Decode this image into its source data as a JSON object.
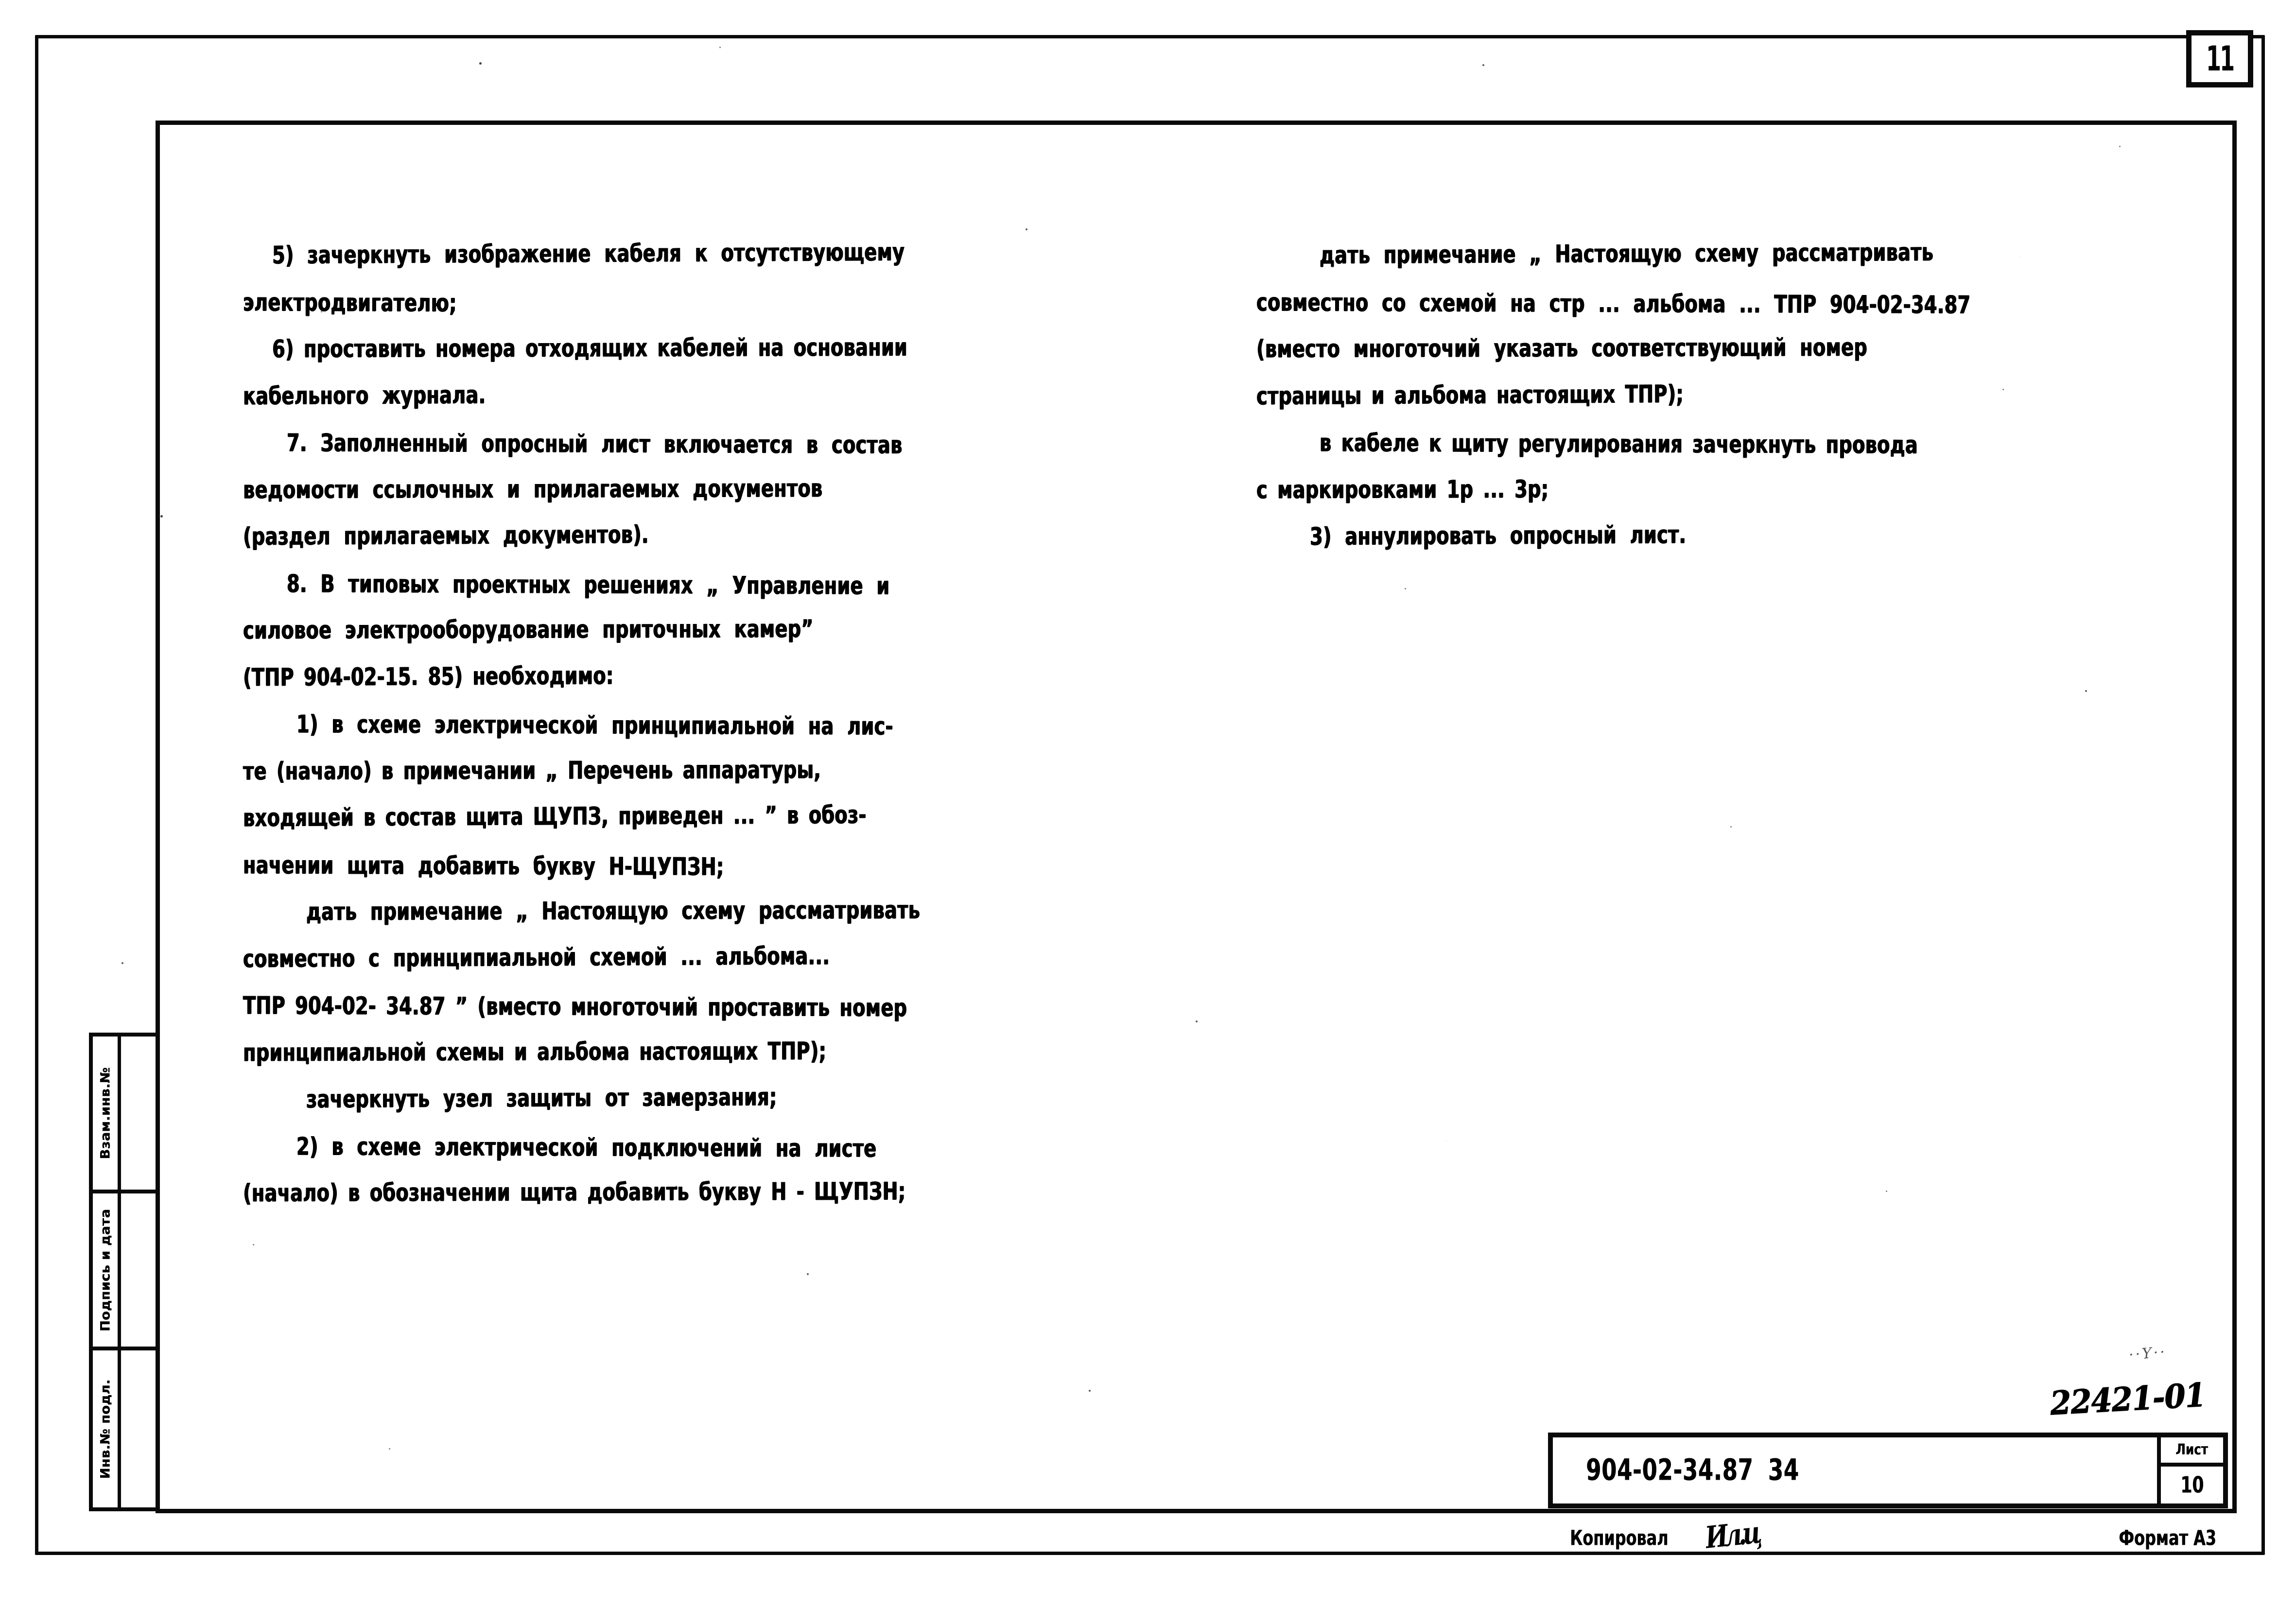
{
  "page": {
    "corner_page_number": "11",
    "sheet_format": "Формат А3",
    "copied_label": "Копировал",
    "copier_signature": "Ил.ц",
    "stamp_number": "22421-01",
    "stamp_smudge": "··Υ··"
  },
  "title_block": {
    "designation": "904-02-34.87  34",
    "sheet_label": "Лист",
    "sheet_number": "10"
  },
  "sidebar": {
    "cells": [
      {
        "label": "Взам.инв.№",
        "value": ""
      },
      {
        "label": "Подпись и дата",
        "value": ""
      },
      {
        "label": "Инв.№ подл.",
        "value": ""
      }
    ]
  },
  "body": {
    "left_column": [
      {
        "id": "l1",
        "text": "5) зачеркнуть изображение кабеля  к отсутствующему",
        "indent": 60,
        "spacing": "wide"
      },
      {
        "id": "l2",
        "text": "электродвигателю;",
        "indent": 0,
        "spacing": "tight"
      },
      {
        "id": "l3",
        "text": "6) проставить  номера отходящих кабелей на основании",
        "indent": 60,
        "spacing": "normal"
      },
      {
        "id": "l4",
        "text": "кабельного  журнала.",
        "indent": 0,
        "spacing": "wide"
      },
      {
        "id": "l5",
        "text": "7. Заполненный  опросный лист  включается  в  состав",
        "indent": 90,
        "spacing": "wide"
      },
      {
        "id": "l6",
        "text": "ведомости  ссылочных  и  прилагаемых  документов",
        "indent": 0,
        "spacing": "wide"
      },
      {
        "id": "l7",
        "text": "(раздел  прилагаемых   документов).",
        "indent": 0,
        "spacing": "wide"
      },
      {
        "id": "l8",
        "text": "8. В типовых  проектных  решениях  „ Управление  и",
        "indent": 90,
        "spacing": "wide"
      },
      {
        "id": "l9",
        "text": "силовое  электрооборудование  приточных  камер”",
        "indent": 0,
        "spacing": "wide"
      },
      {
        "id": "l10",
        "text": "(ТПР 904-02-15. 85)  необходимо:",
        "indent": 0,
        "spacing": "normal"
      },
      {
        "id": "l11",
        "text": "1) в  схеме   электрической   принципиальной на лис-",
        "indent": 110,
        "spacing": "wide"
      },
      {
        "id": "l12",
        "text": "те (начало)  в примечании  „ Перечень  аппаратуры,",
        "indent": 0,
        "spacing": "normal"
      },
      {
        "id": "l13",
        "text": "входящей  в состав  щита  ЩУПЗ, приведен ...      ” в обоз-",
        "indent": 0,
        "spacing": "normal"
      },
      {
        "id": "l14",
        "text": "начении  щита  добавить  букву  Н-ЩУПЗН;",
        "indent": 0,
        "spacing": "wide"
      },
      {
        "id": "l15",
        "text": "дать  примечание  „ Настоящую  схему  рассматривать",
        "indent": 130,
        "spacing": "wide"
      },
      {
        "id": "l16",
        "text": "совместно  с принципиальной  схемой ...          альбома...",
        "indent": 0,
        "spacing": "wide"
      },
      {
        "id": "l17",
        "text": "ТПР 904-02- 34.87 ” (вместо многоточий проставить номер",
        "indent": 0,
        "spacing": "normal"
      },
      {
        "id": "l18",
        "text": "принципиальной  схемы  и альбома настоящих ТПР);",
        "indent": 0,
        "spacing": "normal"
      },
      {
        "id": "l19",
        "text": "зачеркнуть  узел  защиты  от  замерзания;",
        "indent": 130,
        "spacing": "wide"
      },
      {
        "id": "l20",
        "text": "2) в схеме  электрической  подключений  на листе",
        "indent": 110,
        "spacing": "wide"
      },
      {
        "id": "l21",
        "text": "(начало)  в обозначении  щита  добавить  букву  Н - ЩУПЗН;",
        "indent": 0,
        "spacing": "normal"
      }
    ],
    "right_column": [
      {
        "id": "r1",
        "text": "дать  примечание   „ Настоящую  схему  рассматривать",
        "indent": 130,
        "spacing": "wide"
      },
      {
        "id": "r2",
        "text": "совместно  со  схемой   на стр ...     альбома ... ТПР 904-02-34.87",
        "indent": 0,
        "spacing": "wide"
      },
      {
        "id": "r3",
        "text": "(вместо многоточий  указать  соответствующий   номер",
        "indent": 0,
        "spacing": "wide"
      },
      {
        "id": "r4",
        "text": "страницы  и альбома настоящих ТПР);",
        "indent": 0,
        "spacing": "normal"
      },
      {
        "id": "r5",
        "text": "в кабеле к щиту  регулирования зачеркнуть провода",
        "indent": 130,
        "spacing": "normal"
      },
      {
        "id": "r6",
        "text": "с маркировками  1р ...  3р;",
        "indent": 0,
        "spacing": "normal"
      },
      {
        "id": "r7",
        "text": "3) аннулировать  опросный  лист.",
        "indent": 110,
        "spacing": "wide"
      }
    ]
  }
}
